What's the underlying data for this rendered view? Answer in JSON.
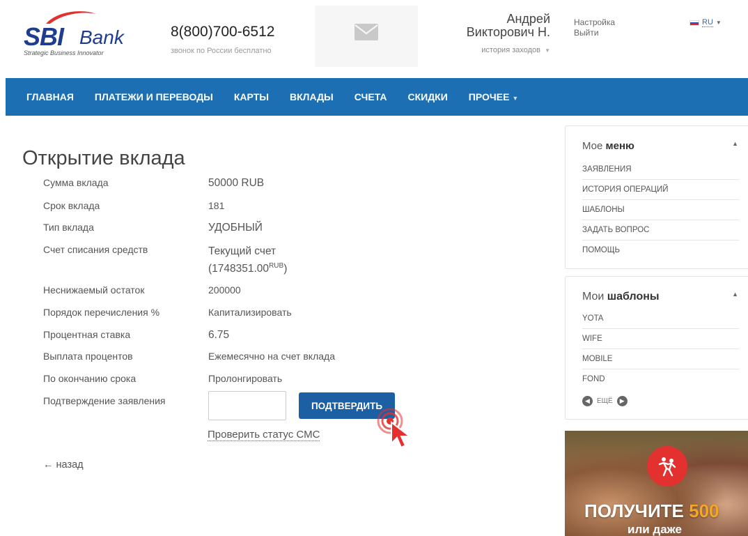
{
  "brand": {
    "logo_main": "SBI",
    "logo_secondary": "Bank",
    "tagline": "Strategic Business Innovator"
  },
  "contact": {
    "phone": "8(800)700-6512",
    "phone_note": "звонок по России бесплатно"
  },
  "user": {
    "first_name": "Андрей",
    "last_name": "Викторович Н.",
    "history_label": "история заходов"
  },
  "account_links": {
    "settings": "Настройка",
    "logout": "Выйти"
  },
  "language": {
    "code": "RU"
  },
  "nav": {
    "items": [
      "ГЛАВНАЯ",
      "ПЛАТЕЖИ И ПЕРЕВОДЫ",
      "КАРТЫ",
      "ВКЛАДЫ",
      "СЧЕТА",
      "СКИДКИ",
      "ПРОЧЕЕ"
    ]
  },
  "main": {
    "title": "Открытие вклада",
    "fields": [
      {
        "label": "Сумма вклада",
        "value": "50000 RUB"
      },
      {
        "label": "Срок вклада",
        "value": "181"
      },
      {
        "label": "Тип вклада",
        "value": "УДОБНЫЙ"
      },
      {
        "label": "Счет списания средств",
        "value": "Текущий счет",
        "value_line2": "(1748351.00",
        "value_sup": "RUB",
        "value_close": ")"
      },
      {
        "label": "Неснижаемый остаток",
        "value": "200000"
      },
      {
        "label": "Порядок перечисления %",
        "value": "Капитализировать"
      },
      {
        "label": "Процентная ставка",
        "value": "6.75"
      },
      {
        "label": "Выплата процентов",
        "value": "Ежемесячно на счет вклада"
      },
      {
        "label": "По окончанию срока",
        "value": "Пролонгировать"
      },
      {
        "label": "Подтверждение заявления",
        "value": ""
      }
    ],
    "confirm_input_value": "",
    "confirm_button": "ПОДТВЕРДИТЬ",
    "check_sms_link": "Проверить статус СМС",
    "back_link": "← назад"
  },
  "sidebar": {
    "menu": {
      "title_prefix": "Мое",
      "title_bold": "меню",
      "items": [
        "ЗАЯВЛЕНИЯ",
        "ИСТОРИЯ ОПЕРАЦИЙ",
        "ШАБЛОНЫ",
        "ЗАДАТЬ ВОПРОС",
        "ПОМОЩЬ"
      ]
    },
    "templates": {
      "title_prefix": "Мои",
      "title_bold": "шаблоны",
      "items": [
        "YOTA",
        "WIFE",
        "MOBILE",
        "FOND"
      ],
      "more_label": "ЕЩЁ"
    },
    "promo": {
      "title_word": "ПОЛУЧИТЕ",
      "title_number": "500",
      "subtitle": "или даже"
    }
  },
  "colors": {
    "nav_bg": "#1c6fb3",
    "button_bg": "#1c5fa3",
    "brand_blue": "#1e3d8f",
    "brand_red": "#e2312f",
    "promo_accent": "#f5a623"
  }
}
